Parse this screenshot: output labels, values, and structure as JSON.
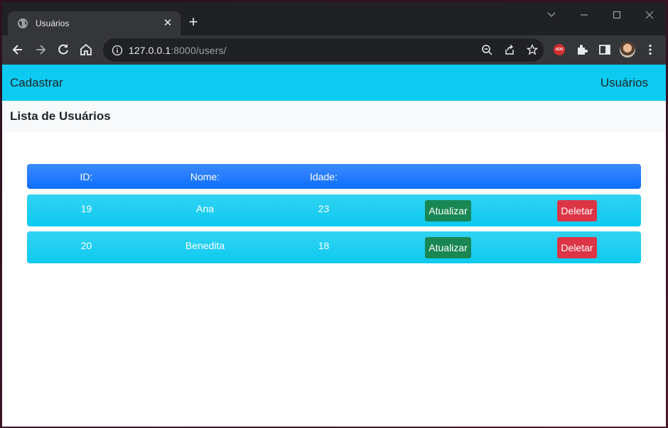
{
  "browser": {
    "tab_title": "Usuários",
    "url_host": "127.0.0.1",
    "url_rest": ":8000/users/"
  },
  "navbar": {
    "left_link": "Cadastrar",
    "right_link": "Usuários"
  },
  "page_title": "Lista de Usuários",
  "table": {
    "headers": [
      "ID:",
      "Nome:",
      "Idade:"
    ],
    "rows": [
      {
        "id": "19",
        "name": "Ana",
        "age": "23",
        "update_label": "Atualizar",
        "delete_label": "Deletar"
      },
      {
        "id": "20",
        "name": "Benedita",
        "age": "18",
        "update_label": "Atualizar",
        "delete_label": "Deletar"
      }
    ]
  },
  "colors": {
    "navbar": "#0dcaf0",
    "header_row": "#0d6efd",
    "update_button": "#198754",
    "delete_button": "#dc3545"
  }
}
